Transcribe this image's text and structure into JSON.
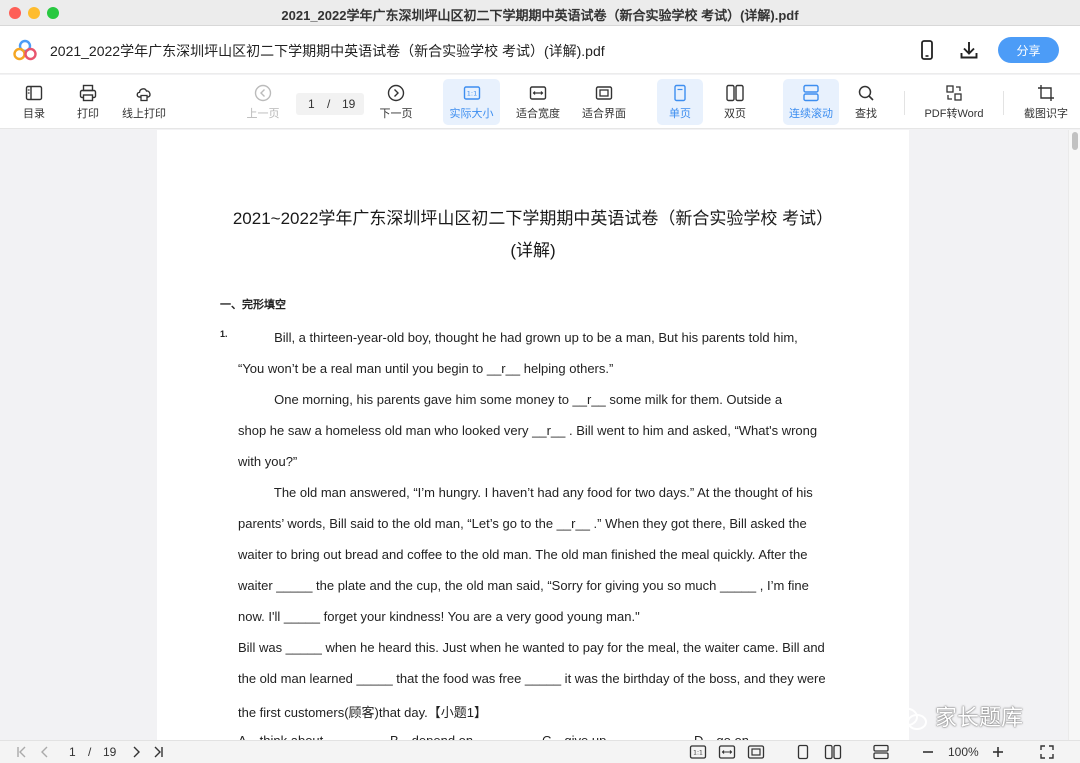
{
  "window": {
    "title": "2021_2022学年广东深圳坪山区初二下学期期中英语试卷（新合实验学校 考试）(详解).pdf"
  },
  "header": {
    "doc_title": "2021_2022学年广东深圳坪山区初二下学期期中英语试卷（新合实验学校 考试）(详解).pdf",
    "icons": [
      "phone-icon",
      "download-icon"
    ],
    "share_label": "分享"
  },
  "toolbar": {
    "toc": "目录",
    "print": "打印",
    "online_print": "线上打印",
    "prev_page": "上一页",
    "page_current": "1",
    "page_sep": "/",
    "page_total": "19",
    "next_page": "下一页",
    "actual_size": "实际大小",
    "fit_width": "适合宽度",
    "fit_page": "适合界面",
    "single_page": "单页",
    "double_page": "双页",
    "continuous_scroll": "连续滚动",
    "find": "查找",
    "pdf_to_word": "PDF转Word",
    "ocr": "截图识字"
  },
  "document": {
    "title_line1": "2021~2022学年广东深圳坪山区初二下学期期中英语试卷（新合实验学校 考试）",
    "title_line2": "(详解)",
    "section": "一、完形填空",
    "question_number": "1.",
    "lines": [
      "          Bill, a thirteen-year-old boy, thought he had grown up to be a man, But his parents told him,",
      "“You won’t be a real man until you begin to __r__ helping others.”",
      "          One morning, his parents gave him some money to __r__ some milk for them. Outside a",
      "shop he saw a homeless old man who looked very __r__ . Bill went to him and asked, “What's wrong",
      "with you?”",
      "          The old man answered, “I’m hungry. I haven’t had any food for two days.” At the thought of his",
      "parents’ words, Bill said to the old man, “Let’s go to the __r__ .” When they got there, Bill asked the",
      "waiter to bring out bread and coffee to the old man. The old man finished the meal quickly. After the",
      "waiter _____ the plate and the cup, the old man said, “Sorry for giving you so much _____ , I’m fine",
      "now. I'll _____ forget your kindness! You are a very good young man.\"",
      "Bill was _____ when he heard this. Just when he wanted to pay for the meal, the waiter came. Bill and",
      "the old man learned _____ that the food was free _____ it was the birthday of the boss, and they were",
      "the first customers(顾客)that day.【小题1】"
    ],
    "options": [
      "A．think about",
      "B．depend on",
      "C．give up",
      "D．go on"
    ]
  },
  "watermark": {
    "text": "家长题库"
  },
  "bottom": {
    "page_current": "1",
    "page_sep": "/",
    "page_total": "19",
    "zoom": "100%"
  },
  "colors": {
    "accent": "#3d8ef0",
    "share_bg": "#4c9cf7",
    "active_bg": "#e8f1fd"
  }
}
